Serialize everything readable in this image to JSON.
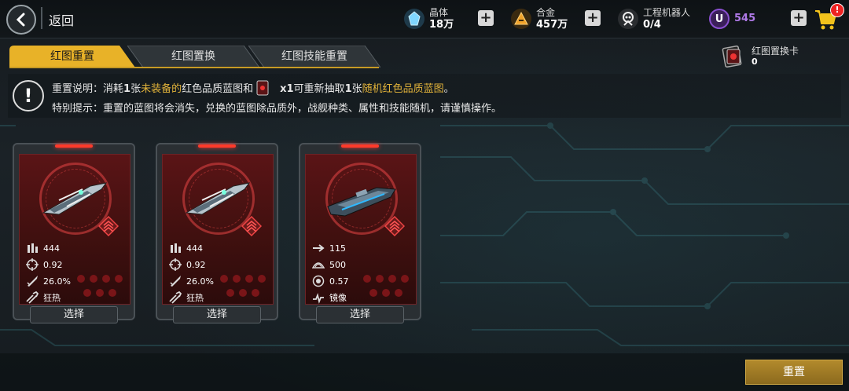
{
  "nav": {
    "back_label": "返回"
  },
  "resources": {
    "crystal": {
      "name": "晶体",
      "value": "18万"
    },
    "alloy": {
      "name": "合金",
      "value": "457万"
    },
    "robot": {
      "name": "工程机器人",
      "value": "0/4"
    },
    "premium": {
      "icon_label": "U",
      "value": "545"
    }
  },
  "shop_badge": "!",
  "tabs": [
    {
      "label": "红图重置",
      "active": true
    },
    {
      "label": "红图置换",
      "active": false
    },
    {
      "label": "红图技能重置",
      "active": false
    }
  ],
  "exchange_card": {
    "name": "红图置换卡",
    "count": "0"
  },
  "info": {
    "icon_label": "!",
    "line1_prefix": "重置说明：消耗",
    "line1_num": "1",
    "line1_zhang": "张",
    "line1_hl1": "未装备的",
    "line1_mid": "红色品质蓝图和",
    "line1_qty": "x1",
    "line1_after": "可重新抽取",
    "line1_num2": "1",
    "line1_zhang2": "张",
    "line1_hl2": "随机红色品质蓝图",
    "line1_end": "。",
    "line2": "特别提示：重置的蓝图将会消失，兑换的蓝图除品质外，战舰种类、属性和技能随机，请谨慎操作。"
  },
  "cards": [
    {
      "stats": [
        {
          "icon": "ammo-icon",
          "value": "444"
        },
        {
          "icon": "crosshair-icon",
          "value": "0.92"
        },
        {
          "icon": "missile-icon",
          "value": "26.0%"
        },
        {
          "icon": "skill-icon",
          "value": "狂热"
        }
      ],
      "button": "选择"
    },
    {
      "stats": [
        {
          "icon": "ammo-icon",
          "value": "444"
        },
        {
          "icon": "crosshair-icon",
          "value": "0.92"
        },
        {
          "icon": "missile-icon",
          "value": "26.0%"
        },
        {
          "icon": "skill-icon",
          "value": "狂热"
        }
      ],
      "button": "选择"
    },
    {
      "stats": [
        {
          "icon": "speed-arrow-icon",
          "value": "115"
        },
        {
          "icon": "armor-icon",
          "value": "500"
        },
        {
          "icon": "shield-icon",
          "value": "0.57"
        },
        {
          "icon": "skill-icon",
          "value": "镜像"
        }
      ],
      "button": "选择"
    }
  ],
  "reset_button": "重置",
  "colors": {
    "accent_gold": "#c79a24",
    "highlight_text": "#e2b33a",
    "card_red": "#5a1416",
    "premium_purple": "#8a4fd0"
  }
}
